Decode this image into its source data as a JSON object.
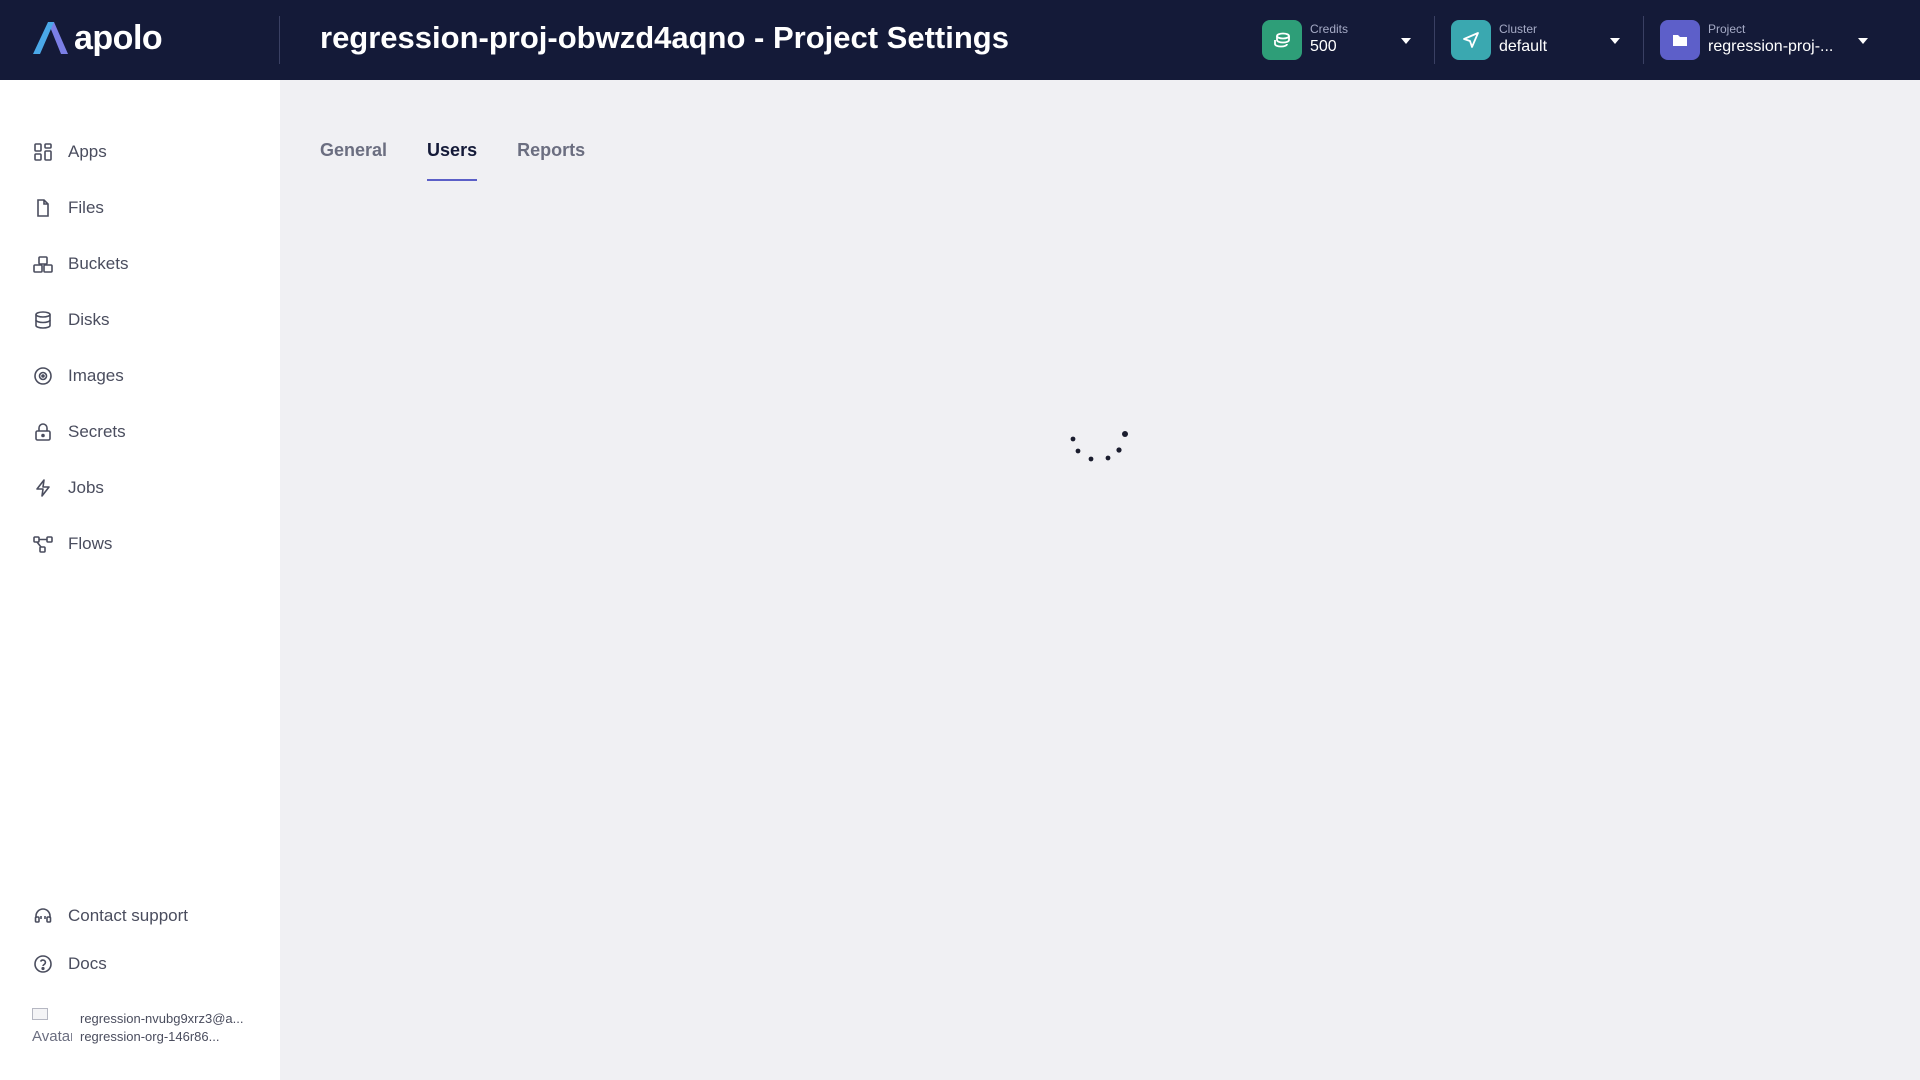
{
  "app": {
    "logo_text": "apolo"
  },
  "header": {
    "title": "regression-proj-obwzd4aqno - Project Settings",
    "credits": {
      "label": "Credits",
      "value": "500",
      "color": "#2e9e78"
    },
    "cluster": {
      "label": "Cluster",
      "value": "default",
      "color": "#3aa8b0"
    },
    "project": {
      "label": "Project",
      "value": "regression-proj-...",
      "color": "#5d5fc9"
    }
  },
  "sidebar": {
    "items": [
      {
        "label": "Apps",
        "icon": "grid-icon"
      },
      {
        "label": "Files",
        "icon": "file-icon"
      },
      {
        "label": "Buckets",
        "icon": "bucket-icon"
      },
      {
        "label": "Disks",
        "icon": "database-icon"
      },
      {
        "label": "Images",
        "icon": "image-disc-icon"
      },
      {
        "label": "Secrets",
        "icon": "lock-icon"
      },
      {
        "label": "Jobs",
        "icon": "lightning-icon"
      },
      {
        "label": "Flows",
        "icon": "flow-icon"
      }
    ],
    "footer": [
      {
        "label": "Contact support",
        "icon": "headset-icon"
      },
      {
        "label": "Docs",
        "icon": "help-circle-icon"
      }
    ],
    "user": {
      "avatar_alt": "Avatar",
      "email": "regression-nvubg9xrz3@a...",
      "org": "regression-org-146r86..."
    }
  },
  "tabs": [
    {
      "label": "General",
      "active": false
    },
    {
      "label": "Users",
      "active": true
    },
    {
      "label": "Reports",
      "active": false
    }
  ],
  "accent_color": "#5b5fc7",
  "header_bg": "#141a38"
}
